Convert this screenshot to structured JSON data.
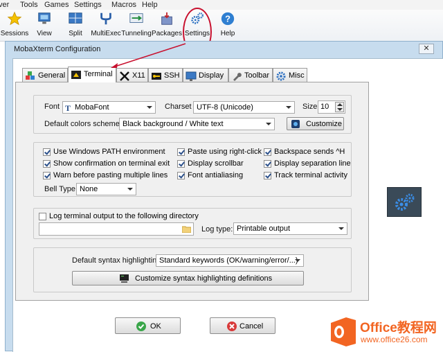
{
  "menu": [
    "ver",
    "Tools",
    "Games",
    "Settings",
    "Macros",
    "Help"
  ],
  "toolbar": [
    {
      "label": "Sessions",
      "icon": "star-icon"
    },
    {
      "label": "View",
      "icon": "monitor-icon"
    },
    {
      "label": "Split",
      "icon": "split-window-icon"
    },
    {
      "label": "MultiExec",
      "icon": "fork-icon"
    },
    {
      "label": "Tunneling",
      "icon": "tunnel-icon"
    },
    {
      "label": "Packages",
      "icon": "package-icon"
    },
    {
      "label": "Settings",
      "icon": "gears-icon"
    },
    {
      "label": "Help",
      "icon": "help-icon"
    }
  ],
  "dialog": {
    "title": "MobaXterm Configuration",
    "close": "✕",
    "tabs": [
      {
        "label": "General",
        "icon": "cubes-icon"
      },
      {
        "label": "Terminal",
        "icon": "terminal-icon"
      },
      {
        "label": "X11",
        "icon": "x11-icon"
      },
      {
        "label": "SSH",
        "icon": "key-icon"
      },
      {
        "label": "Display",
        "icon": "display-icon"
      },
      {
        "label": "Toolbar",
        "icon": "wrench-icon"
      },
      {
        "label": "Misc",
        "icon": "gear-icon"
      }
    ],
    "active_tab": "Terminal"
  },
  "terminal": {
    "font_label": "Font",
    "font_value": "MobaFont",
    "charset_label": "Charset",
    "charset_value": "UTF-8 (Unicode)",
    "size_label": "Size",
    "size_value": "10",
    "colors_label": "Default colors scheme:",
    "colors_value": "Black background / White text",
    "customize_label": "Customize",
    "options": [
      {
        "label": "Use Windows PATH environment",
        "checked": true
      },
      {
        "label": "Paste using right-click",
        "checked": true
      },
      {
        "label": "Backspace sends ^H",
        "checked": true
      },
      {
        "label": "Show confirmation on terminal exit",
        "checked": true
      },
      {
        "label": "Display scrollbar",
        "checked": true
      },
      {
        "label": "Display separation line",
        "checked": true
      },
      {
        "label": "Warn before pasting multiple lines",
        "checked": true
      },
      {
        "label": "Font antialiasing",
        "checked": true
      },
      {
        "label": "Track terminal activity",
        "checked": true
      }
    ],
    "bell_label": "Bell Type:",
    "bell_value": "None",
    "log_label": "Log terminal output to the following directory",
    "log_checked": false,
    "log_path": "",
    "log_type_label": "Log type:",
    "log_type_value": "Printable output",
    "syntax_label": "Default syntax highlighting:",
    "syntax_value": "Standard keywords (OK/warning/error/...)",
    "syntax_customize_label": "Customize syntax highlighting definitions"
  },
  "buttons": {
    "ok": "OK",
    "cancel": "Cancel"
  },
  "watermark": {
    "brand": "Office教程网",
    "url": "www.office26.com"
  },
  "colors": {
    "dialog_border": "#c7dcee",
    "annotation_red": "#c8102e",
    "watermark_orange": "#f26522"
  }
}
